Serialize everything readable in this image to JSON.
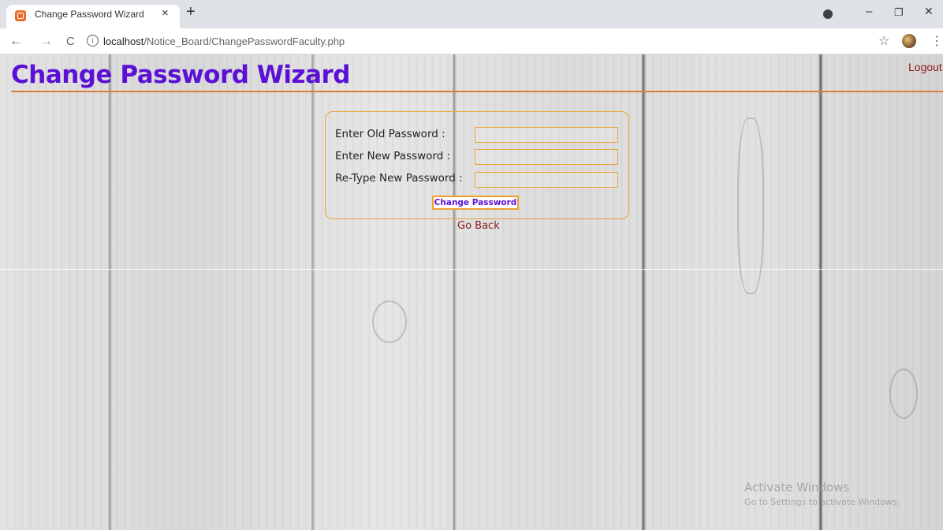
{
  "browser": {
    "tab_title": "Change Password Wizard",
    "tab_close_glyph": "×",
    "new_tab_glyph": "+",
    "back_glyph": "←",
    "forward_glyph": "→",
    "reload_glyph": "C",
    "info_glyph": "i",
    "url_host": "localhost",
    "url_path": "/Notice_Board/ChangePasswordFaculty.php",
    "star_glyph": "☆",
    "menu_glyph": "⋮",
    "minimize_glyph": "–",
    "restore_glyph": "❐",
    "close_glyph": "✕"
  },
  "page": {
    "title": "Change Password Wizard",
    "logout_label": "Logout",
    "form": {
      "old_password_label": "Enter Old Password :",
      "new_password_label": "Enter New Password :",
      "retype_password_label": "Re-Type New Password :",
      "submit_label": "Change Password"
    },
    "go_back_label": "Go Back"
  },
  "watermark": {
    "line1": "Activate Windows",
    "line2": "Go to Settings to activate Windows."
  },
  "colors": {
    "title": "#5b10d6",
    "rule": "#e07a3a",
    "link": "#8b1a1a",
    "border": "#e8a53a"
  }
}
